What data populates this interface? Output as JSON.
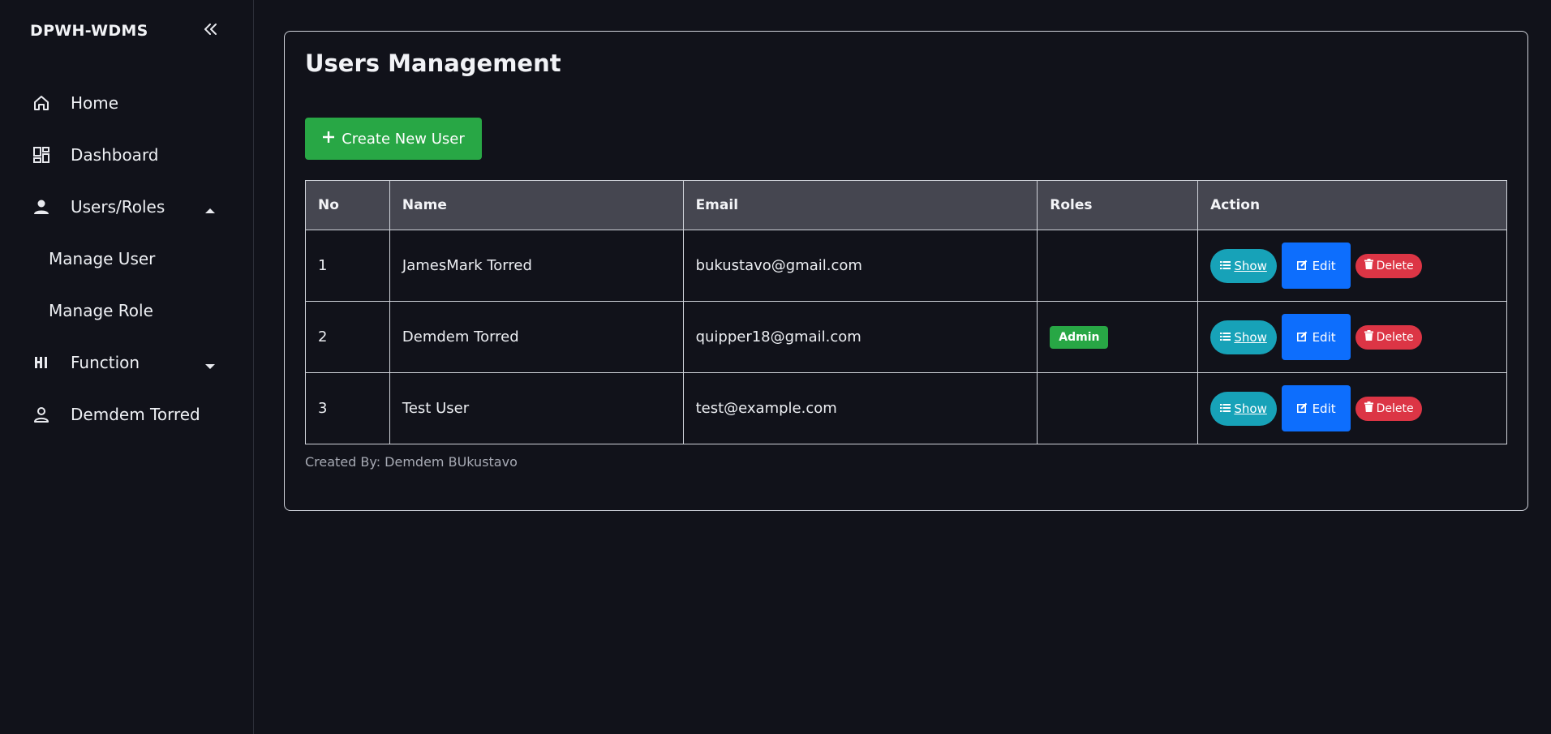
{
  "sidebar": {
    "brand": "DPWH-WDMS",
    "items": [
      {
        "label": "Home",
        "icon": "home-icon"
      },
      {
        "label": "Dashboard",
        "icon": "dashboard-icon"
      },
      {
        "label": "Users/Roles",
        "icon": "user-icon",
        "expanded": true
      },
      {
        "label": "Manage User"
      },
      {
        "label": "Manage Role"
      },
      {
        "label": "Function",
        "icon": "function-icon",
        "expanded": false
      },
      {
        "label": "Demdem Torred",
        "icon": "profile-icon"
      }
    ]
  },
  "main": {
    "title": "Users Management",
    "create_label": "Create New User",
    "table": {
      "headers": [
        "No",
        "Name",
        "Email",
        "Roles",
        "Action"
      ],
      "rows": [
        {
          "no": "1",
          "name": "JamesMark Torred",
          "email": "bukustavo@gmail.com",
          "role": ""
        },
        {
          "no": "2",
          "name": "Demdem Torred",
          "email": "quipper18@gmail.com",
          "role": "Admin"
        },
        {
          "no": "3",
          "name": "Test User",
          "email": "test@example.com",
          "role": ""
        }
      ],
      "actions": {
        "show": "Show",
        "edit": "Edit",
        "delete": "Delete"
      }
    },
    "footer": "Created By: Demdem BUkustavo"
  },
  "colors": {
    "background": "#11121a",
    "create": "#28a745",
    "show": "#17a2b8",
    "edit": "#0d6efd",
    "delete": "#dc3545",
    "header": "#454650"
  }
}
